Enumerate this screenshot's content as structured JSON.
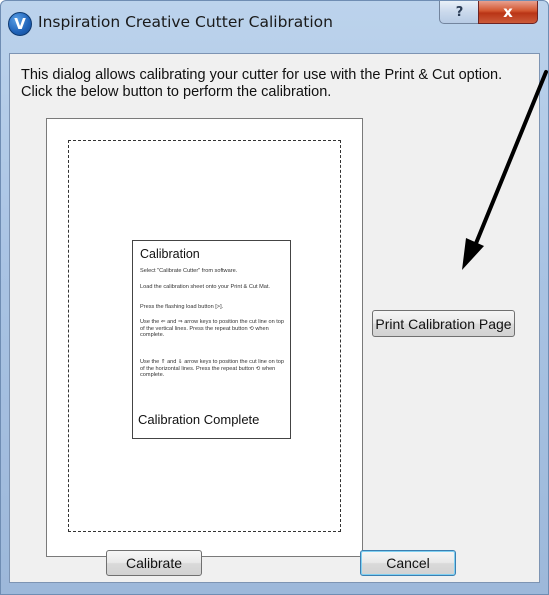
{
  "window": {
    "title": "Inspiration Creative Cutter Calibration",
    "app_icon_letter": "V",
    "help_glyph": "?",
    "close_glyph": "x"
  },
  "dialog": {
    "description_line1": "This dialog allows calibrating your cutter for use with the Print & Cut option.",
    "description_line2": "Click the below button to perform the calibration."
  },
  "preview": {
    "card_title": "Calibration",
    "step1": "Select \"Calibrate Cutter\" from software.",
    "step2": "Load the calibration sheet onto your Print & Cut Mat.",
    "step3": "Press the flashing load button [>].",
    "step4": "Use the ⇐ and ⇒ arrow keys to position the cut line on top of the vertical lines. Press the repeat button ⟲ when complete.",
    "step5": "Use the ⇑ and ⇓ arrow keys to position the cut line on top of the horizontal lines. Press the repeat button ⟲ when complete.",
    "card_footer": "Calibration Complete"
  },
  "buttons": {
    "print_label": "Print Calibration Page",
    "calibrate_label": "Calibrate",
    "cancel_label": "Cancel"
  },
  "colors": {
    "titlebar": "#a9c3e3",
    "close_button": "#c94a2a",
    "client_bg": "#f0f0f0",
    "default_button_border": "#3c7fb1"
  }
}
